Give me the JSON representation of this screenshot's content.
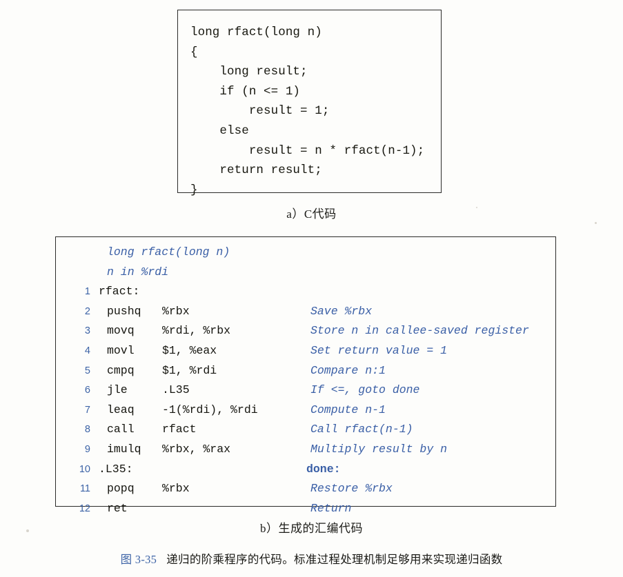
{
  "figure": {
    "label": "图 3-35",
    "text": "递归的阶乘程序的代码。标准过程处理机制足够用来实现递归函数"
  },
  "panel_a": {
    "caption": "a）C代码",
    "code": "long rfact(long n)\n{\n    long result;\n    if (n <= 1)\n        result = 1;\n    else\n        result = n * rfact(n-1);\n    return result;\n}"
  },
  "panel_b": {
    "caption": "b）生成的汇编代码",
    "headers": [
      "long rfact(long n)",
      "n in %rdi"
    ],
    "rows": [
      {
        "num": "1",
        "mnemonic": "rfact:",
        "operands": "",
        "comment": "",
        "is_label": true,
        "comment_is_target": false
      },
      {
        "num": "2",
        "mnemonic": "pushq",
        "operands": "%rbx",
        "comment": "Save %rbx",
        "is_label": false,
        "comment_is_target": false
      },
      {
        "num": "3",
        "mnemonic": "movq",
        "operands": "%rdi, %rbx",
        "comment": "Store n in callee-saved register",
        "is_label": false,
        "comment_is_target": false
      },
      {
        "num": "4",
        "mnemonic": "movl",
        "operands": "$1, %eax",
        "comment": "Set return value = 1",
        "is_label": false,
        "comment_is_target": false
      },
      {
        "num": "5",
        "mnemonic": "cmpq",
        "operands": "$1, %rdi",
        "comment": "Compare n:1",
        "is_label": false,
        "comment_is_target": false
      },
      {
        "num": "6",
        "mnemonic": "jle",
        "operands": ".L35",
        "comment": "If <=, goto done",
        "is_label": false,
        "comment_is_target": false
      },
      {
        "num": "7",
        "mnemonic": "leaq",
        "operands": "-1(%rdi), %rdi",
        "comment": "Compute n-1",
        "is_label": false,
        "comment_is_target": false
      },
      {
        "num": "8",
        "mnemonic": "call",
        "operands": "rfact",
        "comment": "Call rfact(n-1)",
        "is_label": false,
        "comment_is_target": false
      },
      {
        "num": "9",
        "mnemonic": "imulq",
        "operands": "%rbx, %rax",
        "comment": "Multiply result by n",
        "is_label": false,
        "comment_is_target": false
      },
      {
        "num": "10",
        "mnemonic": ".L35:",
        "operands": "",
        "comment": "done:",
        "is_label": true,
        "comment_is_target": true
      },
      {
        "num": "11",
        "mnemonic": "popq",
        "operands": "%rbx",
        "comment": "Restore %rbx",
        "is_label": false,
        "comment_is_target": false
      },
      {
        "num": "12",
        "mnemonic": "ret",
        "operands": "",
        "comment": "Return",
        "is_label": false,
        "comment_is_target": false
      }
    ]
  },
  "colors": {
    "ink": "#17170f",
    "accent_blue": "#3a5fa6",
    "lineno_blue": "#3c63a6",
    "border": "#2a2a28",
    "page": "#fdfdfb"
  }
}
